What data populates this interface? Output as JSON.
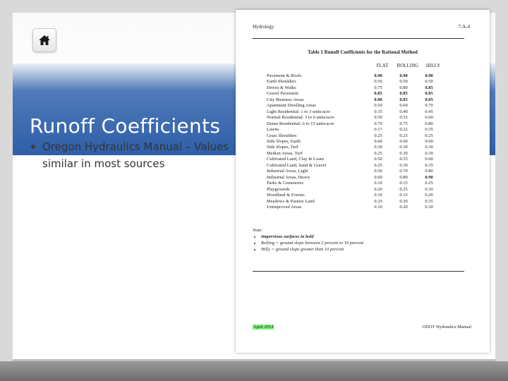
{
  "slide": {
    "title": "Runoff Coefficients",
    "bullets": [
      "Oregon Hydraulics Manual – Values similar in most sources"
    ]
  },
  "icons": {
    "home": "home-icon"
  },
  "colors": {
    "band": "#2f5fa8",
    "highlight": "#7ef17e"
  },
  "document": {
    "header_left": "Hydrology",
    "header_right": "7-A-4",
    "table_title": "Table 1  Runoff Coefficients for the Rational Method",
    "columns": [
      "FLAT",
      "ROLLING",
      "HILLY"
    ],
    "rows": [
      {
        "label": "Pavement & Roofs",
        "flat": "0.90",
        "rolling": "0.90",
        "hilly": "0.90",
        "bold": [
          "flat",
          "rolling",
          "hilly"
        ]
      },
      {
        "label": "Earth Shoulders",
        "flat": "0.50",
        "rolling": "0.50",
        "hilly": "0.50",
        "bold": []
      },
      {
        "label": "Drives & Walks",
        "flat": "0.75",
        "rolling": "0.80",
        "hilly": "0.85",
        "bold": [
          "hilly"
        ]
      },
      {
        "label": "Gravel Pavement",
        "flat": "0.85",
        "rolling": "0.85",
        "hilly": "0.85",
        "bold": [
          "flat",
          "rolling",
          "hilly"
        ]
      },
      {
        "label": "City Business Areas",
        "flat": "0.80",
        "rolling": "0.85",
        "hilly": "0.85",
        "bold": [
          "flat",
          "rolling",
          "hilly"
        ]
      },
      {
        "label": "Apartment Dwelling Areas",
        "flat": "0.50",
        "rolling": "0.60",
        "hilly": "0.70",
        "bold": []
      },
      {
        "label": "Light Residential: 1 to 3 units/acre",
        "flat": "0.35",
        "rolling": "0.40",
        "hilly": "0.45",
        "bold": []
      },
      {
        "label": "Normal Residential: 3 to 6 units/acre",
        "flat": "0.50",
        "rolling": "0.55",
        "hilly": "0.60",
        "bold": []
      },
      {
        "label": "Dense Residential: 6 to 15 units/acre",
        "flat": "0.70",
        "rolling": "0.75",
        "hilly": "0.80",
        "bold": []
      },
      {
        "label": "Lawns",
        "flat": "0.17",
        "rolling": "0.22",
        "hilly": "0.35",
        "bold": []
      },
      {
        "label": "Grass Shoulders",
        "flat": "0.25",
        "rolling": "0.25",
        "hilly": "0.25",
        "bold": []
      },
      {
        "label": "Side Slopes, Earth",
        "flat": "0.60",
        "rolling": "0.60",
        "hilly": "0.60",
        "bold": []
      },
      {
        "label": "Side Slopes, Turf",
        "flat": "0.30",
        "rolling": "0.30",
        "hilly": "0.30",
        "bold": []
      },
      {
        "label": "Median Areas, Turf",
        "flat": "0.25",
        "rolling": "0.30",
        "hilly": "0.30",
        "bold": []
      },
      {
        "label": "Cultivated Land, Clay & Loam",
        "flat": "0.50",
        "rolling": "0.55",
        "hilly": "0.60",
        "bold": []
      },
      {
        "label": "Cultivated Land, Sand & Gravel",
        "flat": "0.25",
        "rolling": "0.30",
        "hilly": "0.35",
        "bold": []
      },
      {
        "label": "Industrial Areas, Light",
        "flat": "0.50",
        "rolling": "0.70",
        "hilly": "0.80",
        "bold": []
      },
      {
        "label": "Industrial Areas, Heavy",
        "flat": "0.60",
        "rolling": "0.80",
        "hilly": "0.90",
        "bold": [
          "hilly"
        ]
      },
      {
        "label": "Parks & Cemeteries",
        "flat": "0.10",
        "rolling": "0.15",
        "hilly": "0.25",
        "bold": []
      },
      {
        "label": "Playgrounds",
        "flat": "0.20",
        "rolling": "0.25",
        "hilly": "0.30",
        "bold": []
      },
      {
        "label": "Woodland & Forests",
        "flat": "0.10",
        "rolling": "0.15",
        "hilly": "0.20",
        "bold": []
      },
      {
        "label": "Meadows & Pasture Land",
        "flat": "0.25",
        "rolling": "0.30",
        "hilly": "0.35",
        "bold": []
      },
      {
        "label": "Unimproved Areas",
        "flat": "0.10",
        "rolling": "0.20",
        "hilly": "0.30",
        "bold": []
      }
    ],
    "notes_header": "Note:",
    "notes": [
      {
        "text": "Impervious surfaces in bold",
        "bold": true
      },
      {
        "text": "Rolling = ground slope between 2 percent to 10 percent",
        "bold": false
      },
      {
        "text": "Hilly = ground slope greater than 10 percent",
        "bold": false
      }
    ],
    "footer_left": "April 2014",
    "footer_right": "ODOT Hydraulics Manual"
  }
}
